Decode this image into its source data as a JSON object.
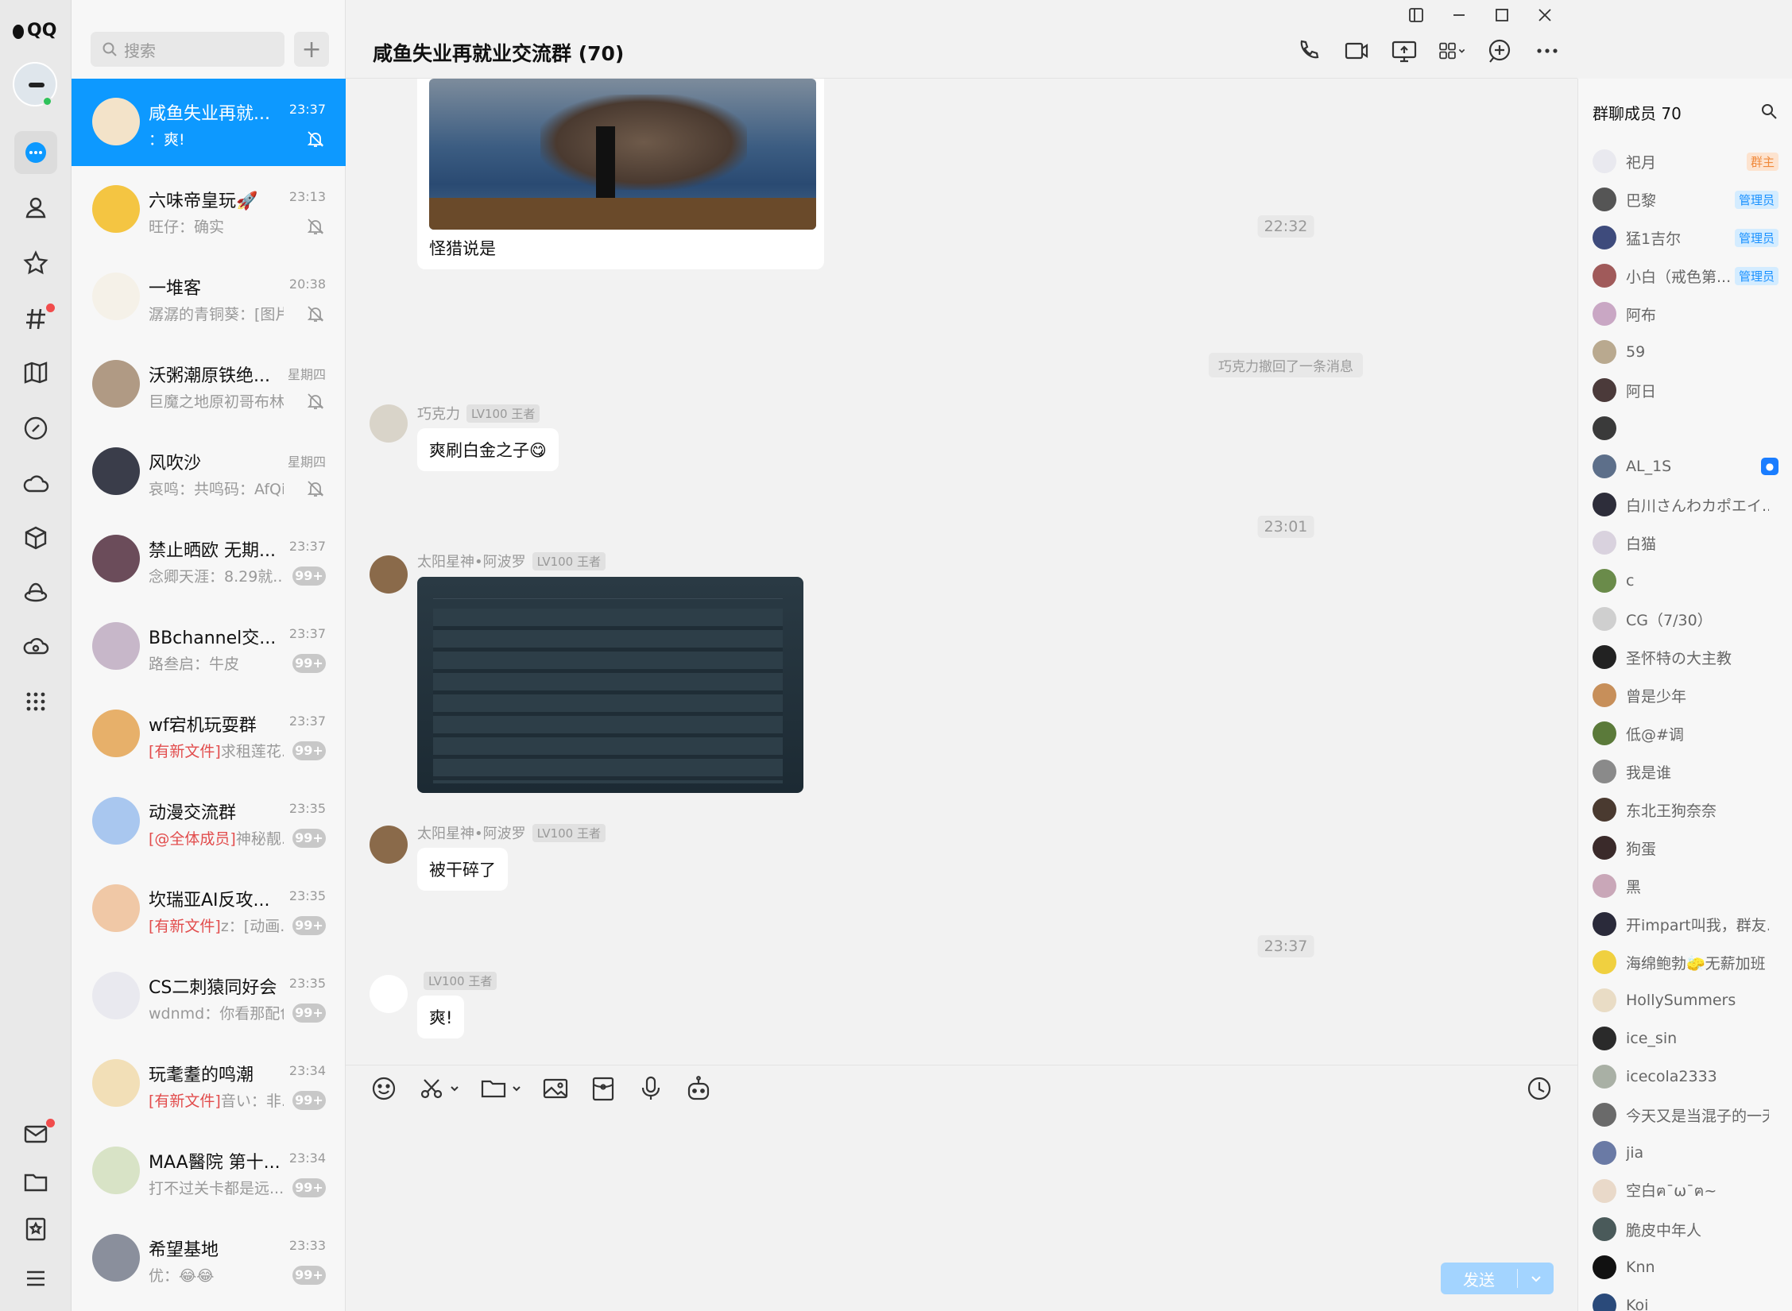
{
  "app": {
    "logo_text": "QQ"
  },
  "search": {
    "placeholder": "搜索"
  },
  "conversations": [
    {
      "name": "咸鱼失业再就...",
      "time": "23:37",
      "last": "：爽!",
      "muted": true,
      "active": true,
      "color": "#f3e3c9"
    },
    {
      "name": "六味帝皇玩🚀",
      "time": "23:13",
      "last": "旺仔：确实",
      "muted": true,
      "color": "#f4c542"
    },
    {
      "name": "一堆客",
      "time": "20:38",
      "last": "潺潺的青铜葵：[图片]",
      "muted": true,
      "color": "#f5f1e8"
    },
    {
      "name": "沃粥潮原铁绝...",
      "time": "星期四",
      "last": "巨魔之地原初哥布林：...",
      "muted": true,
      "color": "#b09a84"
    },
    {
      "name": "风吹沙",
      "time": "星期四",
      "last": "哀鸣：共鸣码：AfQiJA...",
      "muted": true,
      "color": "#3a3d4a"
    },
    {
      "name": "禁止晒欧 无期...",
      "time": "23:37",
      "last": "念卿天涯：8.29就...",
      "badge": "99+",
      "color": "#6b4c5a"
    },
    {
      "name": "BBchannel交...",
      "time": "23:37",
      "last": "路叁启：牛皮",
      "badge": "99+",
      "color": "#c7b7c9"
    },
    {
      "name": "wf宕机玩耍群",
      "time": "23:37",
      "last_hl": "[有新文件]",
      "last": "求租莲花...",
      "badge": "99+",
      "color": "#e7b06a"
    },
    {
      "name": "动漫交流群",
      "time": "23:35",
      "last_hl": "[@全体成员]",
      "last": "神秘靓...",
      "badge": "99+",
      "color": "#a9c7ef"
    },
    {
      "name": "坎瑞亚AI反攻...",
      "time": "23:35",
      "last_hl": "[有新文件]",
      "last": "z：[动画...",
      "badge": "99+",
      "color": "#f0c8a6"
    },
    {
      "name": "CS二刺猿同好会",
      "time": "23:35",
      "last": "wdnmd：你看那配色",
      "badge": "99+",
      "color": "#e9e9ef"
    },
    {
      "name": "玩耄耋的鸣潮",
      "time": "23:34",
      "last_hl": "[有新文件]",
      "last": "音い：非...",
      "badge": "99+",
      "color": "#f2dfb7"
    },
    {
      "name": "MAA醫院 第十...",
      "time": "23:34",
      "last": "打不过关卡都是远...",
      "badge": "99+",
      "color": "#d8e3c6"
    },
    {
      "name": "希望基地",
      "time": "23:33",
      "last": "优：😂😂",
      "badge": "99+",
      "color": "#8a8f9c"
    }
  ],
  "chat": {
    "title": "咸鱼失业再就业交流群 (70)",
    "messages": {
      "caption1": "怪猎说是",
      "time1": "22:32",
      "recall": "巧克力撤回了一条消息",
      "sender1": "巧克力",
      "lv": "LV100 王者",
      "msg1": "爽刷白金之子😋",
      "time2": "23:01",
      "sender2": "太阳星神•阿波罗",
      "msg3": "被干碎了",
      "time3": "23:37",
      "msg4": "爽!"
    },
    "send_label": "发送"
  },
  "members": {
    "title": "群聊成员 70",
    "list": [
      {
        "name": "祀月",
        "role": "群主",
        "role_type": "owner",
        "color": "#e9e9ef"
      },
      {
        "name": "巴黎",
        "role": "管理员",
        "role_type": "admin",
        "color": "#555"
      },
      {
        "name": "猛1吉尔",
        "role": "管理员",
        "role_type": "admin",
        "color": "#3e4b7c"
      },
      {
        "name": "小白（戒色第...",
        "role": "管理员",
        "role_type": "admin",
        "color": "#a05a5a"
      },
      {
        "name": "阿布",
        "color": "#c9a7c4"
      },
      {
        "name": "59",
        "color": "#b9a98f"
      },
      {
        "name": "阿日",
        "color": "#4b3a3a"
      },
      {
        "name": "",
        "color": "#3a3a3a"
      },
      {
        "name": "AL_1S",
        "role": "bot",
        "role_type": "bot",
        "color": "#5d6f8a"
      },
      {
        "name": "白川さんわカポエイ...",
        "color": "#2d2d3a"
      },
      {
        "name": "白猫",
        "color": "#d9d2de"
      },
      {
        "name": "c",
        "color": "#6a8b4a"
      },
      {
        "name": "CG（7/30）",
        "color": "#cfcfcf"
      },
      {
        "name": "圣怀特の大主教",
        "color": "#222"
      },
      {
        "name": "曾是少年",
        "color": "#c78f5a"
      },
      {
        "name": "低@#调",
        "color": "#5b7a3a"
      },
      {
        "name": "我是谁",
        "color": "#8a8a8a"
      },
      {
        "name": "东北王狗奈奈",
        "color": "#4a3a30"
      },
      {
        "name": "狗蛋",
        "color": "#3a2a2a"
      },
      {
        "name": "黑",
        "color": "#c9a7b8"
      },
      {
        "name": "开impart叫我，群友...",
        "color": "#2a2a3a"
      },
      {
        "name": "海绵鲍勃🧽无薪加班",
        "color": "#f0d040"
      },
      {
        "name": "HollySummers",
        "color": "#e9dcc5"
      },
      {
        "name": "ice_sin",
        "color": "#2a2a2a"
      },
      {
        "name": "icecola2333",
        "color": "#a9b0a5"
      },
      {
        "name": "今天又是当混子的一天",
        "color": "#6a6a6a"
      },
      {
        "name": "jia",
        "color": "#6a7aa5"
      },
      {
        "name": "空白ฅ¯ω¯ฅ~",
        "color": "#e9d9c9"
      },
      {
        "name": "脆皮中年人",
        "color": "#4a5a5a"
      },
      {
        "name": "Knn",
        "color": "#111"
      },
      {
        "name": "Koi",
        "color": "#2a4a7a"
      }
    ]
  },
  "colors": {
    "accent": "#0d99ff",
    "badge": "#c8c8c8",
    "highlight": "#e24d4d"
  }
}
